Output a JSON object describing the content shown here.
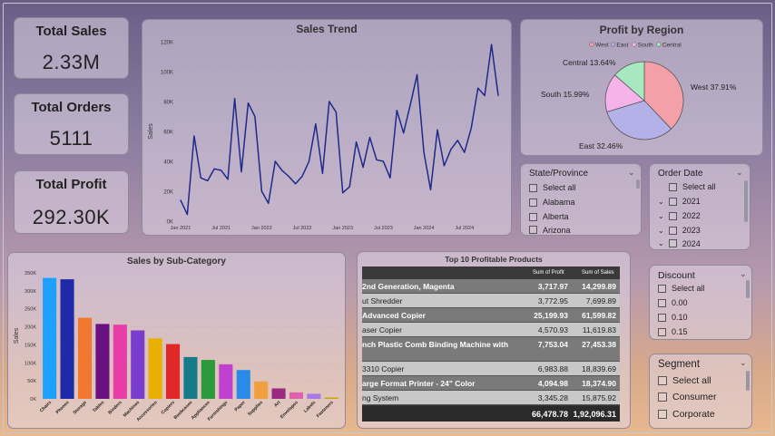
{
  "kpis": {
    "sales": {
      "title": "Total Sales",
      "value": "2.33M"
    },
    "orders": {
      "title": "Total Orders",
      "value": "5111"
    },
    "profit": {
      "title": "Total Profit",
      "value": "292.30K"
    }
  },
  "trend": {
    "title": "Sales Trend",
    "ylabel": "Sales",
    "y_ticks": [
      "120K",
      "100K",
      "80K",
      "60K",
      "40K",
      "20K",
      "0K"
    ],
    "x_ticks": [
      "Jan 2021",
      "Jul 2021",
      "Jan 2022",
      "Jul 2022",
      "Jan 2023",
      "Jul 2023",
      "Jan 2024",
      "Jul 2024"
    ]
  },
  "pie": {
    "title": "Profit by Region",
    "legend": [
      "West",
      "East",
      "South",
      "Central"
    ],
    "labels": [
      "West 37.91%",
      "East 32.46%",
      "South 15.99%",
      "Central 13.64%"
    ]
  },
  "state_slicer": {
    "title": "State/Province",
    "items": [
      "Select all",
      "Alabama",
      "Alberta",
      "Arizona"
    ]
  },
  "date_slicer": {
    "title": "Order Date",
    "items": [
      "Select all",
      "2021",
      "2022",
      "2023",
      "2024"
    ]
  },
  "discount_slicer": {
    "title": "Discount",
    "items": [
      "Select all",
      "0.00",
      "0.10",
      "0.15"
    ]
  },
  "segment_slicer": {
    "title": "Segment",
    "items": [
      "Select all",
      "Consumer",
      "Corporate"
    ]
  },
  "subcat": {
    "title": "Sales by Sub-Category",
    "ylabel": "Sales",
    "y_ticks": [
      "350K",
      "300K",
      "250K",
      "200K",
      "150K",
      "100K",
      "50K",
      "0K"
    ]
  },
  "top10": {
    "title": "Top 10 Profitable Products",
    "headers": [
      "Sum of Profit",
      "Sum of Sales"
    ],
    "rows": [
      {
        "name": "2nd Generation, Magenta",
        "profit": "3,717.97",
        "sales": "14,299.89"
      },
      {
        "name": "ut Shredder",
        "profit": "3,772.95",
        "sales": "7,699.89"
      },
      {
        "name": "Advanced Copier",
        "profit": "25,199.93",
        "sales": "61,599.82"
      },
      {
        "name": "aser Copier",
        "profit": "4,570.93",
        "sales": "11,619.83"
      },
      {
        "name": "nch Plastic Comb Binding Machine with",
        "profit": "7,753.04",
        "sales": "27,453.38"
      },
      {
        "name": "3310 Copier",
        "profit": "6,983.88",
        "sales": "18,839.69"
      },
      {
        "name": "arge Format Printer - 24\" Color",
        "profit": "4,094.98",
        "sales": "18,374.90"
      },
      {
        "name": "ng System",
        "profit": "3,345.28",
        "sales": "15,875.92"
      }
    ],
    "total": {
      "profit": "66,478.78",
      "sales": "1,92,096.31"
    }
  },
  "chart_data": [
    {
      "type": "line",
      "title": "Sales Trend",
      "xlabel": "",
      "ylabel": "Sales",
      "ylim": [
        0,
        120000
      ],
      "x": [
        "2021-01",
        "2021-02",
        "2021-03",
        "2021-04",
        "2021-05",
        "2021-06",
        "2021-07",
        "2021-08",
        "2021-09",
        "2021-10",
        "2021-11",
        "2021-12",
        "2022-01",
        "2022-02",
        "2022-03",
        "2022-04",
        "2022-05",
        "2022-06",
        "2022-07",
        "2022-08",
        "2022-09",
        "2022-10",
        "2022-11",
        "2022-12",
        "2023-01",
        "2023-02",
        "2023-03",
        "2023-04",
        "2023-05",
        "2023-06",
        "2023-07",
        "2023-08",
        "2023-09",
        "2023-10",
        "2023-11",
        "2023-12",
        "2024-01",
        "2024-02",
        "2024-03",
        "2024-04",
        "2024-05",
        "2024-06",
        "2024-07",
        "2024-08",
        "2024-09",
        "2024-10",
        "2024-11",
        "2024-12"
      ],
      "series": [
        {
          "values": [
            14000,
            4500,
            57000,
            29000,
            27000,
            35000,
            34000,
            28000,
            82000,
            33000,
            79000,
            70000,
            20000,
            12000,
            40000,
            34000,
            30000,
            25000,
            30000,
            40000,
            65000,
            32000,
            80000,
            73000,
            19000,
            23000,
            53000,
            36000,
            56000,
            41000,
            40000,
            29000,
            74000,
            59000,
            78000,
            98000,
            46000,
            21000,
            61000,
            37000,
            48000,
            54000,
            46000,
            62000,
            89000,
            84000,
            118000,
            84000
          ],
          "color": "#1e2a8a"
        }
      ],
      "grid": true
    },
    {
      "type": "pie",
      "title": "Profit by Region",
      "categories": [
        "West",
        "East",
        "South",
        "Central"
      ],
      "values": [
        37.91,
        32.46,
        15.99,
        13.64
      ],
      "colors": [
        "#f4a0a8",
        "#b4b0e8",
        "#f6b3ea",
        "#a8e8c0"
      ],
      "legend": "top"
    },
    {
      "type": "bar",
      "title": "Sales by Sub-Category",
      "xlabel": "",
      "ylabel": "Sales",
      "ylim": [
        0,
        350000
      ],
      "categories": [
        "Chairs",
        "Phones",
        "Storage",
        "Tables",
        "Binders",
        "Machines",
        "Accessories",
        "Copiers",
        "Bookcases",
        "Appliances",
        "Furnishings",
        "Paper",
        "Supplies",
        "Art",
        "Envelopes",
        "Labels",
        "Fasteners"
      ],
      "values": [
        336000,
        332000,
        225000,
        208000,
        206000,
        190000,
        168000,
        152000,
        116000,
        108000,
        96000,
        80000,
        48000,
        29000,
        18000,
        14000,
        3900
      ],
      "colors": [
        "#1ea0ff",
        "#1e2aa8",
        "#f07830",
        "#6a1080",
        "#e83ca8",
        "#7a3ccc",
        "#e8b000",
        "#e02828",
        "#157a8a",
        "#2a9a3a",
        "#c040d0",
        "#2a8ae8",
        "#f0a040",
        "#9a2a80",
        "#e060b0",
        "#a87ae8",
        "#c8a800"
      ]
    }
  ]
}
